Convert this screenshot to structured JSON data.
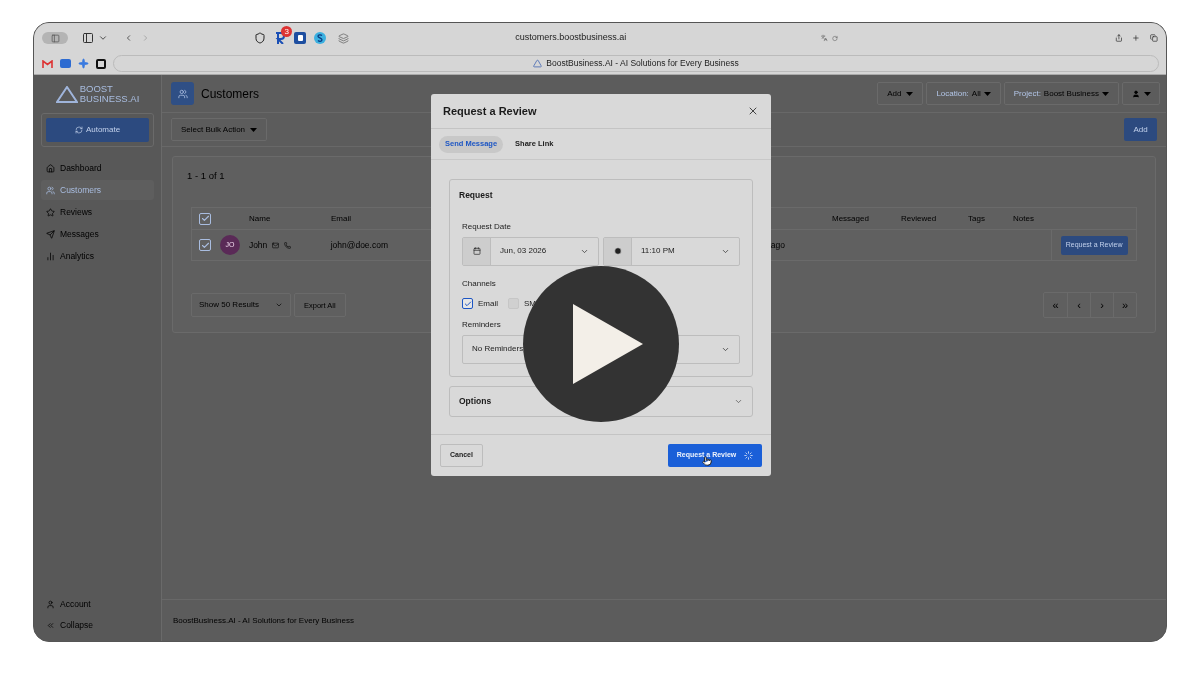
{
  "browser": {
    "extension_badge": "3",
    "url": "customers.boostbusiness.ai",
    "tab_title": "BoostBusiness.AI - AI Solutions for Every Business"
  },
  "sidebar": {
    "logo_lines": [
      "BOOST",
      "BUSINESS.AI"
    ],
    "automate_button": "Automate",
    "items": [
      {
        "label": "Dashboard",
        "kind": "home",
        "selected": false
      },
      {
        "label": "Customers",
        "kind": "users",
        "selected": true
      },
      {
        "label": "Reviews",
        "kind": "star",
        "selected": false
      },
      {
        "label": "Messages",
        "kind": "send",
        "selected": false
      },
      {
        "label": "Analytics",
        "kind": "chart",
        "selected": false
      }
    ],
    "bottom_items": [
      {
        "label": "Account",
        "kind": "user"
      },
      {
        "label": "Collapse",
        "kind": "collapse"
      }
    ]
  },
  "header": {
    "title": "Customers",
    "add_menu": "Add",
    "location": {
      "prefix": "Location:",
      "value": "All"
    },
    "project": {
      "prefix": "Project:",
      "value": "Boost Business"
    }
  },
  "toolbar": {
    "bulk_action": "Select Bulk Action",
    "add_button": "Add"
  },
  "table": {
    "range": "1 - 1 of 1",
    "header_checked": true,
    "columns": [
      "Name",
      "Email",
      "Messaged",
      "Reviewed",
      "Tags",
      "Notes"
    ],
    "rows": [
      {
        "checked": true,
        "initials": "JO",
        "name": "John",
        "email": "john@doe.com",
        "column_3": "ago",
        "action": "Request a Review"
      }
    ],
    "page_size": "Show 50 Results",
    "export": "Export All",
    "pager": [
      "«",
      "‹",
      "›",
      "»"
    ]
  },
  "footer": "BoostBusiness.AI - AI Solutions for Every Business",
  "modal": {
    "title": "Request a Review",
    "tabs": [
      {
        "label": "Send Message",
        "selected": true
      },
      {
        "label": "Share Link",
        "selected": false
      }
    ],
    "section_title": "Request",
    "date_label": "Request Date",
    "date": "Jun, 03 2026",
    "time": "11:10 PM",
    "channels_label": "Channels",
    "channels": [
      {
        "label": "Email",
        "checked": true
      },
      {
        "label": "SM",
        "checked": false
      }
    ],
    "reminders_label": "Reminders",
    "reminders_value": "No Reminders",
    "options_label": "Options",
    "cancel": "Cancel",
    "submit": "Request a Review",
    "submit_loading": true
  }
}
